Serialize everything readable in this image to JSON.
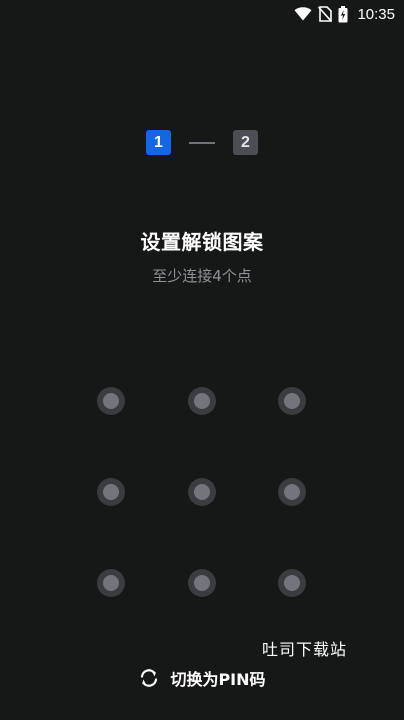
{
  "status_bar": {
    "time": "10:35",
    "icons": [
      "wifi-icon",
      "no-sim-icon",
      "battery-charging-icon"
    ]
  },
  "steps": {
    "current": "1",
    "next": "2"
  },
  "title": "设置解锁图案",
  "subtitle": "至少连接4个点",
  "pattern": {
    "rows": 3,
    "cols": 3
  },
  "watermark": "吐司下载站",
  "switch_pin": {
    "label": "切换为PIN码",
    "icon": "refresh-icon"
  },
  "colors": {
    "background": "#161717",
    "active_step": "#1267e6",
    "inactive_step": "#4b4e55",
    "dot_outer": "#3a3c40",
    "dot_inner": "#72757b"
  }
}
